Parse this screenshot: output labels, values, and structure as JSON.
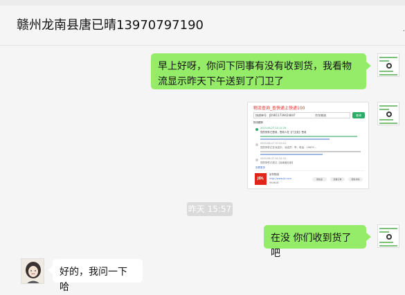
{
  "window": {
    "title": "赣州龙南县唐已晴13970797190",
    "controls": [
      "pin-icon",
      "minimize-icon",
      "maximize-icon",
      "close-icon"
    ]
  },
  "strip": {
    "tabs": [
      "",
      "",
      ""
    ]
  },
  "messages": [
    {
      "id": "m1",
      "side": "right",
      "text": "早上好呀，你问下同事有没有收到货，我看物流显示昨天下午送到了门卫了"
    },
    {
      "id": "m2",
      "side": "right",
      "type": "image",
      "image": {
        "title": "物流查询_查快递上快递100",
        "search_label": "快递单号",
        "search_value": "JDVB11739424847",
        "carrier_select": "京东物流",
        "query_button": "查询",
        "section_label": "物流跟踪",
        "events": [
          {
            "time": "2023-06-27 15:11:29",
            "text": "您的快件已签收，签收人在【门卫处】签收"
          },
          {
            "time": "2023-06-27 07:29:22",
            "text": "您的快件正在派送中，派送员：李，电话：19879... "
          },
          {
            "time": "2023-06-27 01:31:31",
            "text": "您的快件已到达【龙南营业部】"
          }
        ],
        "more_link": "查看更多",
        "carrier_name": "京东物流",
        "carrier_site": "http://www.jd.com",
        "carrier_phone": "950616",
        "logo_text": "JDL",
        "action_buttons": [
          "寄快递",
          "查看订单",
          "服务详情"
        ]
      }
    },
    {
      "id": "ts1",
      "type": "timestamp",
      "text": "昨天 15:57"
    },
    {
      "id": "m3",
      "side": "right",
      "text": "在没 你们收到货了吧"
    },
    {
      "id": "m4",
      "side": "left",
      "text": "好的，我问一下哈"
    }
  ],
  "colors": {
    "outgoing_bubble": "#95ec69",
    "incoming_bubble": "#ffffff",
    "background": "#f5f5f5",
    "timestamp_bg": "#dadada",
    "logistics_red": "#e0312a",
    "logistics_green": "#2aae67"
  }
}
